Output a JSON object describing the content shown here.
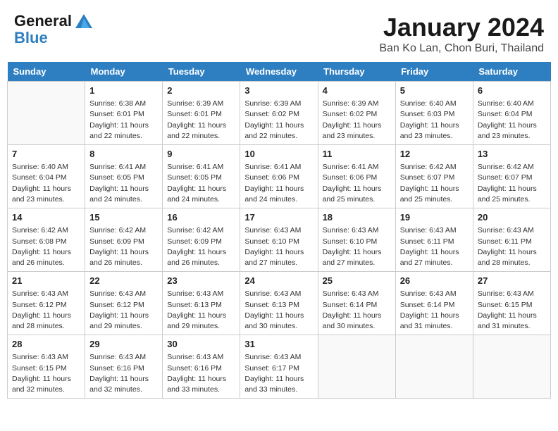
{
  "header": {
    "logo_line1": "General",
    "logo_line2": "Blue",
    "title": "January 2024",
    "subtitle": "Ban Ko Lan, Chon Buri, Thailand"
  },
  "days_of_week": [
    "Sunday",
    "Monday",
    "Tuesday",
    "Wednesday",
    "Thursday",
    "Friday",
    "Saturday"
  ],
  "weeks": [
    [
      {
        "day": "",
        "info": ""
      },
      {
        "day": "1",
        "info": "Sunrise: 6:38 AM\nSunset: 6:01 PM\nDaylight: 11 hours\nand 22 minutes."
      },
      {
        "day": "2",
        "info": "Sunrise: 6:39 AM\nSunset: 6:01 PM\nDaylight: 11 hours\nand 22 minutes."
      },
      {
        "day": "3",
        "info": "Sunrise: 6:39 AM\nSunset: 6:02 PM\nDaylight: 11 hours\nand 22 minutes."
      },
      {
        "day": "4",
        "info": "Sunrise: 6:39 AM\nSunset: 6:02 PM\nDaylight: 11 hours\nand 23 minutes."
      },
      {
        "day": "5",
        "info": "Sunrise: 6:40 AM\nSunset: 6:03 PM\nDaylight: 11 hours\nand 23 minutes."
      },
      {
        "day": "6",
        "info": "Sunrise: 6:40 AM\nSunset: 6:04 PM\nDaylight: 11 hours\nand 23 minutes."
      }
    ],
    [
      {
        "day": "7",
        "info": "Sunrise: 6:40 AM\nSunset: 6:04 PM\nDaylight: 11 hours\nand 23 minutes."
      },
      {
        "day": "8",
        "info": "Sunrise: 6:41 AM\nSunset: 6:05 PM\nDaylight: 11 hours\nand 24 minutes."
      },
      {
        "day": "9",
        "info": "Sunrise: 6:41 AM\nSunset: 6:05 PM\nDaylight: 11 hours\nand 24 minutes."
      },
      {
        "day": "10",
        "info": "Sunrise: 6:41 AM\nSunset: 6:06 PM\nDaylight: 11 hours\nand 24 minutes."
      },
      {
        "day": "11",
        "info": "Sunrise: 6:41 AM\nSunset: 6:06 PM\nDaylight: 11 hours\nand 25 minutes."
      },
      {
        "day": "12",
        "info": "Sunrise: 6:42 AM\nSunset: 6:07 PM\nDaylight: 11 hours\nand 25 minutes."
      },
      {
        "day": "13",
        "info": "Sunrise: 6:42 AM\nSunset: 6:07 PM\nDaylight: 11 hours\nand 25 minutes."
      }
    ],
    [
      {
        "day": "14",
        "info": "Sunrise: 6:42 AM\nSunset: 6:08 PM\nDaylight: 11 hours\nand 26 minutes."
      },
      {
        "day": "15",
        "info": "Sunrise: 6:42 AM\nSunset: 6:09 PM\nDaylight: 11 hours\nand 26 minutes."
      },
      {
        "day": "16",
        "info": "Sunrise: 6:42 AM\nSunset: 6:09 PM\nDaylight: 11 hours\nand 26 minutes."
      },
      {
        "day": "17",
        "info": "Sunrise: 6:43 AM\nSunset: 6:10 PM\nDaylight: 11 hours\nand 27 minutes."
      },
      {
        "day": "18",
        "info": "Sunrise: 6:43 AM\nSunset: 6:10 PM\nDaylight: 11 hours\nand 27 minutes."
      },
      {
        "day": "19",
        "info": "Sunrise: 6:43 AM\nSunset: 6:11 PM\nDaylight: 11 hours\nand 27 minutes."
      },
      {
        "day": "20",
        "info": "Sunrise: 6:43 AM\nSunset: 6:11 PM\nDaylight: 11 hours\nand 28 minutes."
      }
    ],
    [
      {
        "day": "21",
        "info": "Sunrise: 6:43 AM\nSunset: 6:12 PM\nDaylight: 11 hours\nand 28 minutes."
      },
      {
        "day": "22",
        "info": "Sunrise: 6:43 AM\nSunset: 6:12 PM\nDaylight: 11 hours\nand 29 minutes."
      },
      {
        "day": "23",
        "info": "Sunrise: 6:43 AM\nSunset: 6:13 PM\nDaylight: 11 hours\nand 29 minutes."
      },
      {
        "day": "24",
        "info": "Sunrise: 6:43 AM\nSunset: 6:13 PM\nDaylight: 11 hours\nand 30 minutes."
      },
      {
        "day": "25",
        "info": "Sunrise: 6:43 AM\nSunset: 6:14 PM\nDaylight: 11 hours\nand 30 minutes."
      },
      {
        "day": "26",
        "info": "Sunrise: 6:43 AM\nSunset: 6:14 PM\nDaylight: 11 hours\nand 31 minutes."
      },
      {
        "day": "27",
        "info": "Sunrise: 6:43 AM\nSunset: 6:15 PM\nDaylight: 11 hours\nand 31 minutes."
      }
    ],
    [
      {
        "day": "28",
        "info": "Sunrise: 6:43 AM\nSunset: 6:15 PM\nDaylight: 11 hours\nand 32 minutes."
      },
      {
        "day": "29",
        "info": "Sunrise: 6:43 AM\nSunset: 6:16 PM\nDaylight: 11 hours\nand 32 minutes."
      },
      {
        "day": "30",
        "info": "Sunrise: 6:43 AM\nSunset: 6:16 PM\nDaylight: 11 hours\nand 33 minutes."
      },
      {
        "day": "31",
        "info": "Sunrise: 6:43 AM\nSunset: 6:17 PM\nDaylight: 11 hours\nand 33 minutes."
      },
      {
        "day": "",
        "info": ""
      },
      {
        "day": "",
        "info": ""
      },
      {
        "day": "",
        "info": ""
      }
    ]
  ]
}
